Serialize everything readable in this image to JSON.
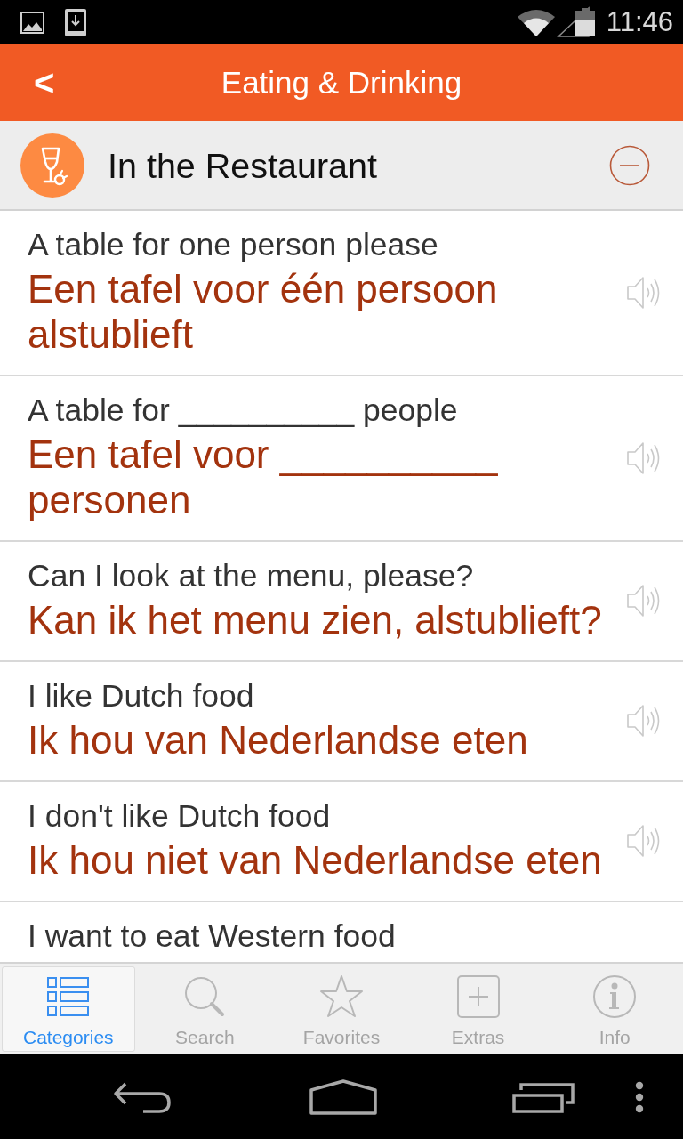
{
  "status_bar": {
    "time": "11:46"
  },
  "app_bar": {
    "back": "<",
    "title": "Eating & Drinking"
  },
  "category": {
    "title": "In the Restaurant",
    "expanded": true
  },
  "phrases": [
    {
      "english": "A table for one person please",
      "dutch": "Een tafel voor één persoon alstublieft"
    },
    {
      "english": "A table for __________ people",
      "dutch": "Een tafel voor __________ personen"
    },
    {
      "english": "Can I look at the menu, please?",
      "dutch": "Kan ik het menu zien, alstublieft?"
    },
    {
      "english": "I like Dutch food",
      "dutch": "Ik hou van Nederlandse eten"
    },
    {
      "english": "I don't like Dutch food",
      "dutch": "Ik hou niet van Nederlandse eten"
    },
    {
      "english": "I want to eat Western food"
    }
  ],
  "tabs": [
    {
      "label": "Categories",
      "kind": "list",
      "selected": true
    },
    {
      "label": "Search",
      "kind": "search",
      "selected": false
    },
    {
      "label": "Favorites",
      "kind": "star",
      "selected": false
    },
    {
      "label": "Extras",
      "kind": "plus",
      "selected": false
    },
    {
      "label": "Info",
      "kind": "info",
      "selected": false
    }
  ]
}
